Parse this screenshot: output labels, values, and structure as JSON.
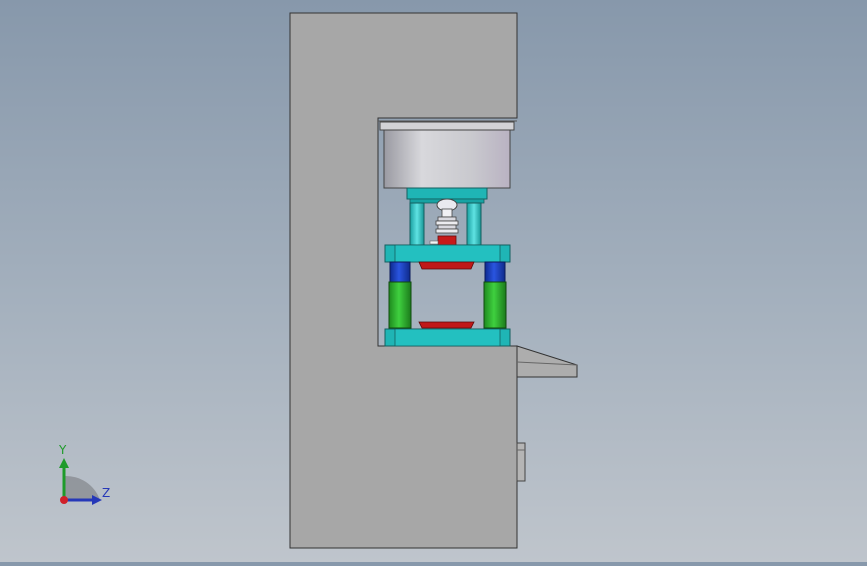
{
  "viewport": {
    "background_top": "#8798ab",
    "background_bottom": "#bfc5cc"
  },
  "model": {
    "frame_color": "#a7a7a7",
    "cylinder_color": "#c8c8cc",
    "plate_color": "#1fb5b5",
    "guide_post_color": "#2fc7c7",
    "bushing_color": "#2ea82e",
    "collar_color": "#1a3fb8",
    "die_color": "#c01818"
  },
  "triad": {
    "y_label": "Y",
    "z_label": "Z",
    "y_color": "#1e9b2a",
    "z_color": "#2638b8",
    "origin_color": "#d0202a",
    "icon": "coordinate-triad-icon"
  }
}
